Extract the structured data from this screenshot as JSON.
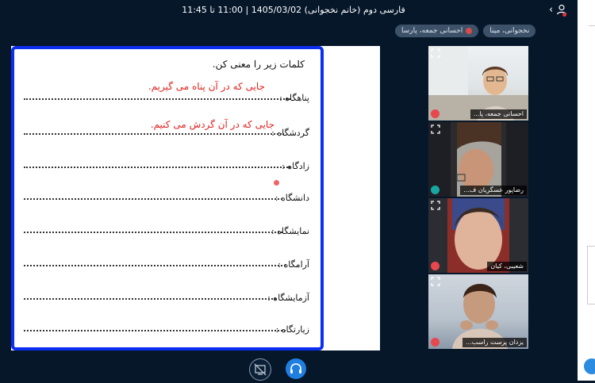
{
  "header": {
    "title": "فارسی دوم (خانم نخجوانی) 1405/03/02 | 11:00 تا 11:45"
  },
  "chips": [
    {
      "label": "نخجوانی، مینا"
    },
    {
      "label": "احسانی جمعه، پارسا"
    }
  ],
  "worksheet": {
    "title": "کلمات زیر را معنی کن.",
    "rows": [
      {
        "label": "پناهگاه :"
      },
      {
        "label": "گردشگاه :"
      },
      {
        "label": "زادگاه :"
      },
      {
        "label": "دانشگاه :"
      },
      {
        "label": "نمایشگاه :"
      },
      {
        "label": "آرامگاه :"
      },
      {
        "label": "آزمایشگاه :"
      },
      {
        "label": "زیارتگاه :"
      }
    ],
    "answers": [
      {
        "text": "جایی که در آن پناه می گیریم."
      },
      {
        "text": "جایی که در آن گردش می کنیم."
      }
    ]
  },
  "participants": [
    {
      "name": "احسانی جمعه، پا...",
      "status": "mic-off",
      "icon": "mic-off-icon"
    },
    {
      "name": "رضاپور عسگریان ف...",
      "status": "headphones",
      "icon": "headphones-icon"
    },
    {
      "name": "شعیبی، کیان",
      "status": "mic-off",
      "icon": "mic-off-icon"
    },
    {
      "name": "یزدان پرست راسب...",
      "status": "mic-off",
      "icon": "mic-off-icon"
    }
  ],
  "colors": {
    "background": "#06172a",
    "worksheet_border": "#0b2ff0",
    "answer_text": "#e0221f",
    "chip": "#3d5268",
    "accent": "#1f7fe0"
  }
}
